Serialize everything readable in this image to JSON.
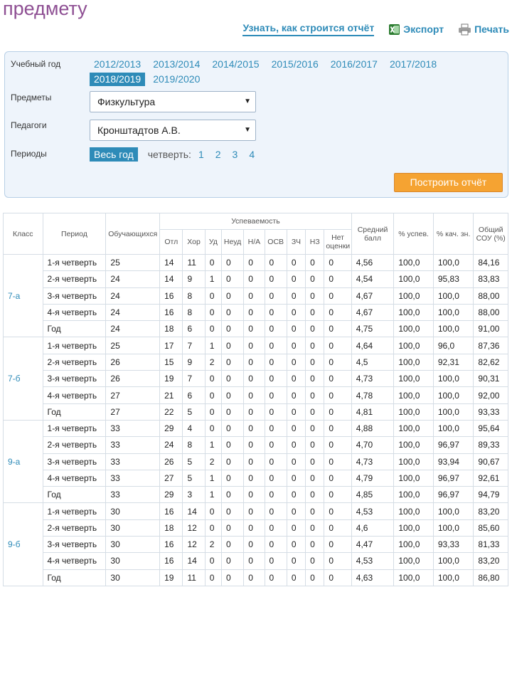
{
  "page": {
    "title": "предмету"
  },
  "links": {
    "learn": "Узнать, как строится отчёт",
    "export": "Экспорт",
    "print": "Печать"
  },
  "filters": {
    "year_label": "Учебный год",
    "years": [
      "2012/2013",
      "2013/2014",
      "2014/2015",
      "2015/2016",
      "2016/2017",
      "2017/2018",
      "2018/2019",
      "2019/2020"
    ],
    "active_year": "2018/2019",
    "subjects_label": "Предметы",
    "subject_value": "Физкультура",
    "teachers_label": "Педагоги",
    "teacher_value": "Кронштадтов А.В.",
    "periods_label": "Периоды",
    "period_all": "Весь год",
    "quarter_label": "четверть:",
    "quarters": [
      "1",
      "2",
      "3",
      "4"
    ],
    "build_button": "Построить отчёт"
  },
  "table": {
    "headers": {
      "class": "Класс",
      "period": "Период",
      "students": "Обучающихся",
      "progress": "Успеваемость",
      "avg1": "Средний",
      "avg2": "балл",
      "pct_success": "% успев.",
      "pct_quality": "% кач. зн.",
      "sou1": "Общий",
      "sou2": "СОУ (%)",
      "grades": [
        "Отл",
        "Хор",
        "Уд",
        "Неуд",
        "Н/А",
        "ОСВ",
        "ЗЧ",
        "НЗ"
      ],
      "no_grade1": "Нет",
      "no_grade2": "оценки"
    },
    "groups": [
      {
        "class": "7-а",
        "rows": [
          {
            "period": "1-я четверть",
            "students": "25",
            "g": [
              "14",
              "11",
              "0",
              "0",
              "0",
              "0",
              "0",
              "0",
              "0"
            ],
            "avg": "4,56",
            "succ": "100,0",
            "qual": "100,0",
            "sou": "84,16"
          },
          {
            "period": "2-я четверть",
            "students": "24",
            "g": [
              "14",
              "9",
              "1",
              "0",
              "0",
              "0",
              "0",
              "0",
              "0"
            ],
            "avg": "4,54",
            "succ": "100,0",
            "qual": "95,83",
            "sou": "83,83"
          },
          {
            "period": "3-я четверть",
            "students": "24",
            "g": [
              "16",
              "8",
              "0",
              "0",
              "0",
              "0",
              "0",
              "0",
              "0"
            ],
            "avg": "4,67",
            "succ": "100,0",
            "qual": "100,0",
            "sou": "88,00"
          },
          {
            "period": "4-я четверть",
            "students": "24",
            "g": [
              "16",
              "8",
              "0",
              "0",
              "0",
              "0",
              "0",
              "0",
              "0"
            ],
            "avg": "4,67",
            "succ": "100,0",
            "qual": "100,0",
            "sou": "88,00"
          },
          {
            "period": "Год",
            "students": "24",
            "g": [
              "18",
              "6",
              "0",
              "0",
              "0",
              "0",
              "0",
              "0",
              "0"
            ],
            "avg": "4,75",
            "succ": "100,0",
            "qual": "100,0",
            "sou": "91,00"
          }
        ]
      },
      {
        "class": "7-б",
        "rows": [
          {
            "period": "1-я четверть",
            "students": "25",
            "g": [
              "17",
              "7",
              "1",
              "0",
              "0",
              "0",
              "0",
              "0",
              "0"
            ],
            "avg": "4,64",
            "succ": "100,0",
            "qual": "96,0",
            "sou": "87,36"
          },
          {
            "period": "2-я четверть",
            "students": "26",
            "g": [
              "15",
              "9",
              "2",
              "0",
              "0",
              "0",
              "0",
              "0",
              "0"
            ],
            "avg": "4,5",
            "succ": "100,0",
            "qual": "92,31",
            "sou": "82,62"
          },
          {
            "period": "3-я четверть",
            "students": "26",
            "g": [
              "19",
              "7",
              "0",
              "0",
              "0",
              "0",
              "0",
              "0",
              "0"
            ],
            "avg": "4,73",
            "succ": "100,0",
            "qual": "100,0",
            "sou": "90,31"
          },
          {
            "period": "4-я четверть",
            "students": "27",
            "g": [
              "21",
              "6",
              "0",
              "0",
              "0",
              "0",
              "0",
              "0",
              "0"
            ],
            "avg": "4,78",
            "succ": "100,0",
            "qual": "100,0",
            "sou": "92,00"
          },
          {
            "period": "Год",
            "students": "27",
            "g": [
              "22",
              "5",
              "0",
              "0",
              "0",
              "0",
              "0",
              "0",
              "0"
            ],
            "avg": "4,81",
            "succ": "100,0",
            "qual": "100,0",
            "sou": "93,33"
          }
        ]
      },
      {
        "class": "9-а",
        "rows": [
          {
            "period": "1-я четверть",
            "students": "33",
            "g": [
              "29",
              "4",
              "0",
              "0",
              "0",
              "0",
              "0",
              "0",
              "0"
            ],
            "avg": "4,88",
            "succ": "100,0",
            "qual": "100,0",
            "sou": "95,64"
          },
          {
            "period": "2-я четверть",
            "students": "33",
            "g": [
              "24",
              "8",
              "1",
              "0",
              "0",
              "0",
              "0",
              "0",
              "0"
            ],
            "avg": "4,70",
            "succ": "100,0",
            "qual": "96,97",
            "sou": "89,33"
          },
          {
            "period": "3-я четверть",
            "students": "33",
            "g": [
              "26",
              "5",
              "2",
              "0",
              "0",
              "0",
              "0",
              "0",
              "0"
            ],
            "avg": "4,73",
            "succ": "100,0",
            "qual": "93,94",
            "sou": "90,67"
          },
          {
            "period": "4-я четверть",
            "students": "33",
            "g": [
              "27",
              "5",
              "1",
              "0",
              "0",
              "0",
              "0",
              "0",
              "0"
            ],
            "avg": "4,79",
            "succ": "100,0",
            "qual": "96,97",
            "sou": "92,61"
          },
          {
            "period": "Год",
            "students": "33",
            "g": [
              "29",
              "3",
              "1",
              "0",
              "0",
              "0",
              "0",
              "0",
              "0"
            ],
            "avg": "4,85",
            "succ": "100,0",
            "qual": "96,97",
            "sou": "94,79"
          }
        ]
      },
      {
        "class": "9-б",
        "rows": [
          {
            "period": "1-я четверть",
            "students": "30",
            "g": [
              "16",
              "14",
              "0",
              "0",
              "0",
              "0",
              "0",
              "0",
              "0"
            ],
            "avg": "4,53",
            "succ": "100,0",
            "qual": "100,0",
            "sou": "83,20"
          },
          {
            "period": "2-я четверть",
            "students": "30",
            "g": [
              "18",
              "12",
              "0",
              "0",
              "0",
              "0",
              "0",
              "0",
              "0"
            ],
            "avg": "4,6",
            "succ": "100,0",
            "qual": "100,0",
            "sou": "85,60"
          },
          {
            "period": "3-я четверть",
            "students": "30",
            "g": [
              "16",
              "12",
              "2",
              "0",
              "0",
              "0",
              "0",
              "0",
              "0"
            ],
            "avg": "4,47",
            "succ": "100,0",
            "qual": "93,33",
            "sou": "81,33"
          },
          {
            "period": "4-я четверть",
            "students": "30",
            "g": [
              "16",
              "14",
              "0",
              "0",
              "0",
              "0",
              "0",
              "0",
              "0"
            ],
            "avg": "4,53",
            "succ": "100,0",
            "qual": "100,0",
            "sou": "83,20"
          },
          {
            "period": "Год",
            "students": "30",
            "g": [
              "19",
              "11",
              "0",
              "0",
              "0",
              "0",
              "0",
              "0",
              "0"
            ],
            "avg": "4,63",
            "succ": "100,0",
            "qual": "100,0",
            "sou": "86,80"
          }
        ]
      }
    ]
  },
  "colors": {
    "link": "#2e8bb8",
    "title": "#8e4f93",
    "button": "#f5a332",
    "panel": "#eef4fb",
    "excel": "#2e7d32"
  },
  "icons": {
    "export": "excel-icon",
    "print": "printer-icon",
    "dropdown": "dropdown-arrow-icon"
  }
}
